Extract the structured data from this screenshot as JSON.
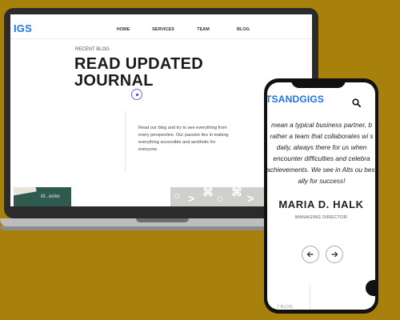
{
  "laptop": {
    "site": {
      "logo": "IGS",
      "nav": [
        "HOME",
        "SERVICES",
        "TEAM",
        "BLOG"
      ],
      "recent_label": "RECENT BLOG",
      "hero_title_line1": "READ UPDATED",
      "hero_title_line2": "JOURNAL",
      "description": "Read our blog and try to see everything from every perspective. Our passion lies in making everything accessible and aesthetic for everyone.",
      "thumb_script": "M...wske"
    }
  },
  "phone": {
    "logo": "TSANDGIGS",
    "quote": "mean a typical business partner, b rather a team that collaborates wi s daily, always there for us when encounter difficulties and celebra achievements. We see in Alts ou best ally for success!",
    "person_name": "MARIA D. HALK",
    "person_role": "MANAGING DIRECTOR",
    "bottom_label": "T BLOG"
  },
  "colors": {
    "background": "#A8800C",
    "brand_blue": "#1e73e8",
    "accent_dot": "#3b3bb0"
  },
  "icons": {
    "search": "search-icon",
    "prev": "arrow-left-icon",
    "next": "arrow-right-icon"
  }
}
